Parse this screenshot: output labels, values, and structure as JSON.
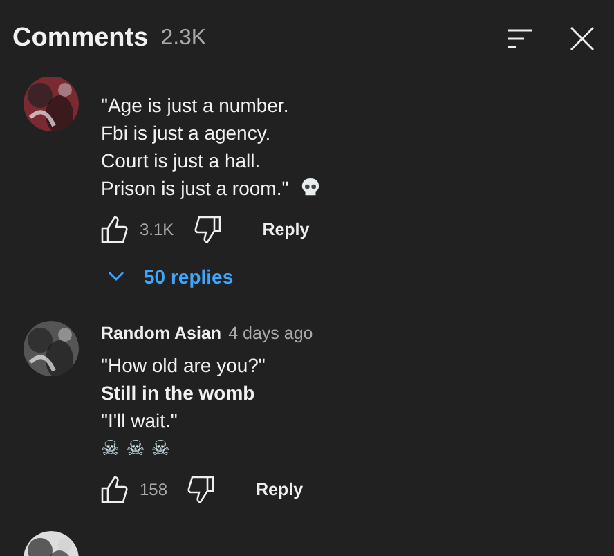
{
  "header": {
    "title": "Comments",
    "count": "2.3K"
  },
  "comments": [
    {
      "avatar": {
        "kind": "picture"
      },
      "lines": [
        {
          "kind": "plain",
          "text": "\"Age is just a number."
        },
        {
          "kind": "plain",
          "text": "Fbi is just a agency."
        },
        {
          "kind": "plain",
          "text": "Court is just a hall."
        },
        {
          "kind": "skull_after",
          "text": "Prison is just a room.\""
        }
      ],
      "likes": "3.1K",
      "reply": "Reply",
      "replies": "50 replies"
    },
    {
      "avatar": {
        "kind": "picture"
      },
      "author": "Random Asian",
      "time": "4 days ago",
      "lines": [
        {
          "kind": "plain",
          "text": "\"How old are you?\""
        },
        {
          "kind": "bold",
          "text": "Still in the womb"
        },
        {
          "kind": "plain",
          "text": "\"I'll wait.\""
        },
        {
          "kind": "emoji",
          "text": "☠ ☠ ☠"
        }
      ],
      "likes": "158",
      "reply": "Reply"
    },
    {
      "avatar": {
        "kind": "picture"
      }
    }
  ]
}
